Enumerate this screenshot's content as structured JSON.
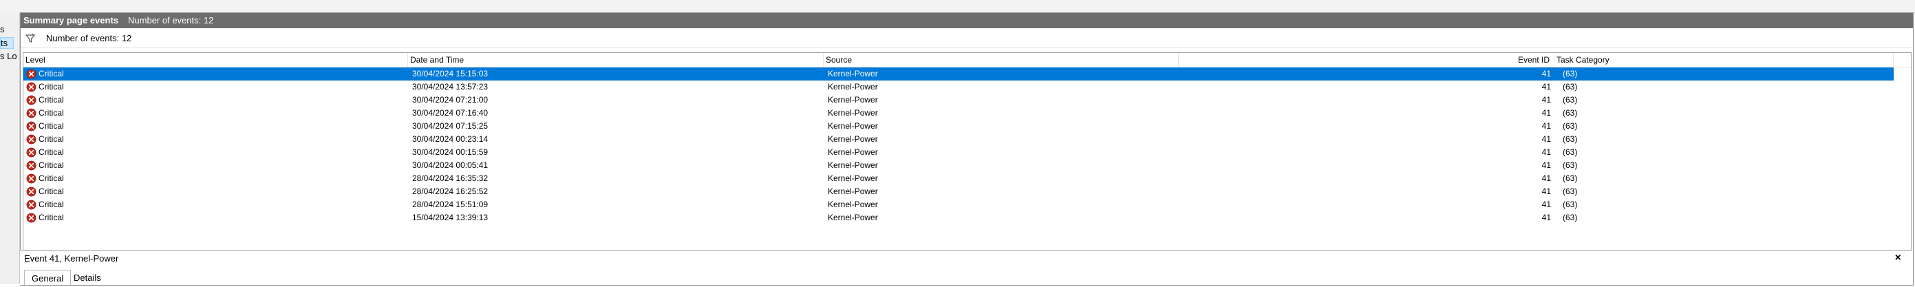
{
  "left_strip": {
    "frag1": "s",
    "frag2": "ts",
    "frag3": "s Lo"
  },
  "panel": {
    "title": "Summary page events",
    "subtitle": "Number of events: 12"
  },
  "filter": {
    "icon": "filter-icon",
    "text": "Number of events: 12"
  },
  "columns": {
    "level": "Level",
    "datetime": "Date and Time",
    "source": "Source",
    "event_id": "Event ID",
    "task_category": "Task Category"
  },
  "events": [
    {
      "level": "Critical",
      "datetime": "30/04/2024 15:15:03",
      "source": "Kernel-Power",
      "event_id": "41",
      "task_category": "(63)"
    },
    {
      "level": "Critical",
      "datetime": "30/04/2024 13:57:23",
      "source": "Kernel-Power",
      "event_id": "41",
      "task_category": "(63)"
    },
    {
      "level": "Critical",
      "datetime": "30/04/2024 07:21:00",
      "source": "Kernel-Power",
      "event_id": "41",
      "task_category": "(63)"
    },
    {
      "level": "Critical",
      "datetime": "30/04/2024 07:16:40",
      "source": "Kernel-Power",
      "event_id": "41",
      "task_category": "(63)"
    },
    {
      "level": "Critical",
      "datetime": "30/04/2024 07:15:25",
      "source": "Kernel-Power",
      "event_id": "41",
      "task_category": "(63)"
    },
    {
      "level": "Critical",
      "datetime": "30/04/2024 00:23:14",
      "source": "Kernel-Power",
      "event_id": "41",
      "task_category": "(63)"
    },
    {
      "level": "Critical",
      "datetime": "30/04/2024 00:15:59",
      "source": "Kernel-Power",
      "event_id": "41",
      "task_category": "(63)"
    },
    {
      "level": "Critical",
      "datetime": "30/04/2024 00:05:41",
      "source": "Kernel-Power",
      "event_id": "41",
      "task_category": "(63)"
    },
    {
      "level": "Critical",
      "datetime": "28/04/2024 16:35:32",
      "source": "Kernel-Power",
      "event_id": "41",
      "task_category": "(63)"
    },
    {
      "level": "Critical",
      "datetime": "28/04/2024 16:25:52",
      "source": "Kernel-Power",
      "event_id": "41",
      "task_category": "(63)"
    },
    {
      "level": "Critical",
      "datetime": "28/04/2024 15:51:09",
      "source": "Kernel-Power",
      "event_id": "41",
      "task_category": "(63)"
    },
    {
      "level": "Critical",
      "datetime": "15/04/2024 13:39:13",
      "source": "Kernel-Power",
      "event_id": "41",
      "task_category": "(63)"
    }
  ],
  "selected_row": 0,
  "details": {
    "title": "Event 41, Kernel-Power",
    "close_label": "×",
    "tabs": [
      {
        "label": "General",
        "active": true
      },
      {
        "label": "Details",
        "active": false
      }
    ]
  },
  "colors": {
    "selection": "#0078d7",
    "titlebar": "#6d6d6d",
    "critical": "#c42b1c"
  },
  "icons": {
    "critical": "critical-error-icon"
  }
}
